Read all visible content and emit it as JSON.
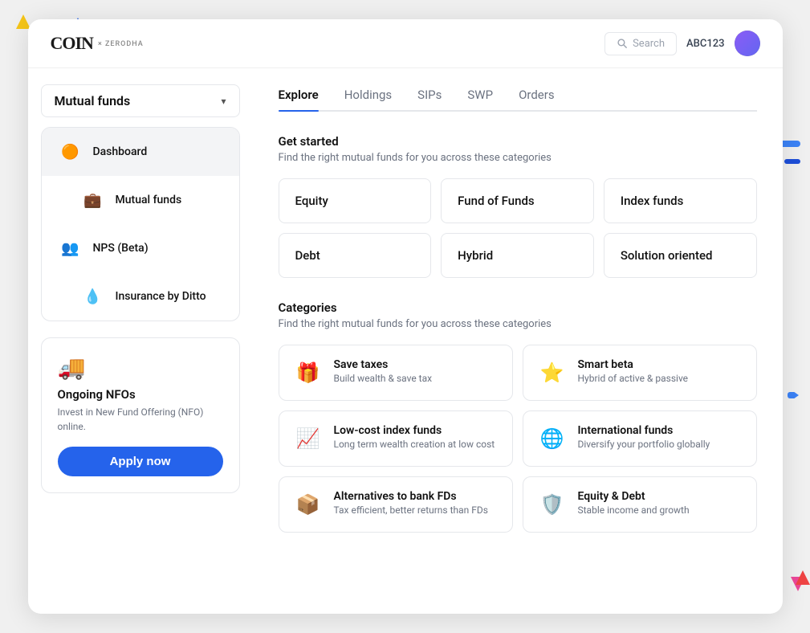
{
  "app": {
    "logo": "COIN",
    "logo_sub": "× ZERODHA"
  },
  "nav": {
    "search_placeholder": "Search",
    "user_id": "ABC123"
  },
  "sidebar": {
    "fund_selector": "Mutual funds",
    "nav_items": [
      {
        "id": "dashboard",
        "label": "Dashboard",
        "icon": "🟠",
        "active": true
      },
      {
        "id": "mutual-funds",
        "label": "Mutual funds",
        "icon": "💼",
        "active": false
      },
      {
        "id": "nps",
        "label": "NPS (Beta)",
        "icon": "👤",
        "active": false
      },
      {
        "id": "insurance",
        "label": "Insurance by Ditto",
        "icon": "💧",
        "active": false
      }
    ],
    "nfo": {
      "title": "Ongoing NFOs",
      "desc": "Invest in New Fund Offering (NFO) online.",
      "apply_label": "Apply now",
      "icon": "🚚"
    }
  },
  "tabs": [
    {
      "label": "Explore",
      "active": true
    },
    {
      "label": "Holdings",
      "active": false
    },
    {
      "label": "SIPs",
      "active": false
    },
    {
      "label": "SWP",
      "active": false
    },
    {
      "label": "Orders",
      "active": false
    }
  ],
  "get_started": {
    "title": "Get started",
    "desc": "Find the right mutual funds for you across these categories"
  },
  "fund_types": [
    {
      "label": "Equity"
    },
    {
      "label": "Fund of Funds"
    },
    {
      "label": "Index funds"
    },
    {
      "label": "Debt"
    },
    {
      "label": "Hybrid"
    },
    {
      "label": "Solution oriented"
    }
  ],
  "categories": {
    "title": "Categories",
    "desc": "Find the right mutual funds for you across these categories",
    "items": [
      {
        "id": "save-taxes",
        "title": "Save taxes",
        "desc": "Build wealth & save tax",
        "icon": "🎁",
        "icon_color": "#ef4444"
      },
      {
        "id": "smart-beta",
        "title": "Smart beta",
        "desc": "Hybrid of active & passive",
        "icon": "⭐",
        "icon_color": "#f59e0b"
      },
      {
        "id": "low-cost",
        "title": "Low-cost index funds",
        "desc": "Long term wealth creation at low cost",
        "icon": "📈",
        "icon_color": "#10b981"
      },
      {
        "id": "international",
        "title": "International funds",
        "desc": "Diversify your portfolio globally",
        "icon": "🌐",
        "icon_color": "#6b7280"
      },
      {
        "id": "alternatives",
        "title": "Alternatives to bank FDs",
        "desc": "Tax efficient, better returns than FDs",
        "icon": "📦",
        "icon_color": "#3b82f6"
      },
      {
        "id": "equity-debt",
        "title": "Equity & Debt",
        "desc": "Stable income and growth",
        "icon": "🛡️",
        "icon_color": "#8b5cf6"
      }
    ]
  }
}
